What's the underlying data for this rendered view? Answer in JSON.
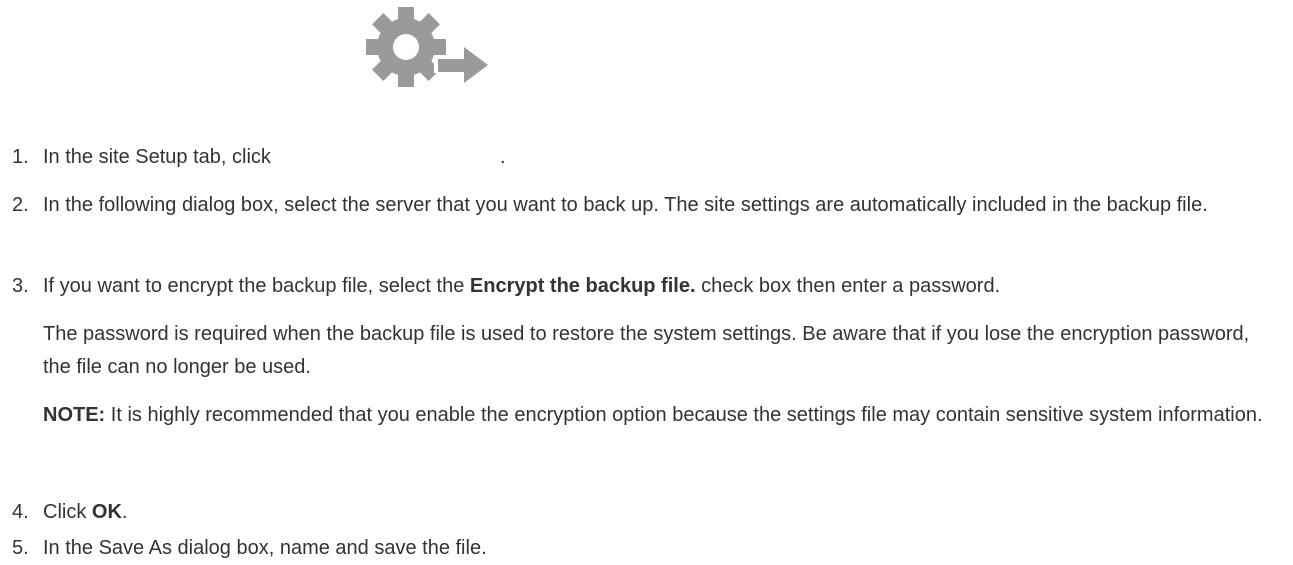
{
  "steps": [
    {
      "number": "1.",
      "text_before": "In the site Setup tab, click",
      "icon": "gear-arrow-icon",
      "text_after": "."
    },
    {
      "number": "2.",
      "text": "In the following dialog box, select the server that you want to back up. The site settings are automatically included in the backup file."
    },
    {
      "number": "3.",
      "text_before": "If you want to encrypt the backup file, select the ",
      "bold": "Encrypt the backup file.",
      "text_after": " check box then enter a password.",
      "paragraph": "The password is required when the backup file is used to restore the system settings. Be aware that if you lose the encryption password, the file can no longer be used.",
      "note_label": "NOTE:",
      "note_text": " It is highly recommended that you enable the encryption option because the settings file may contain sensitive system information."
    },
    {
      "number": "4.",
      "text_before": "Click ",
      "bold": "OK",
      "text_after": "."
    },
    {
      "number": "5.",
      "text": "In the Save As dialog box, name and save the file."
    }
  ],
  "colors": {
    "text": "#333333",
    "icon": "#9a9a9a",
    "background": "#ffffff"
  }
}
